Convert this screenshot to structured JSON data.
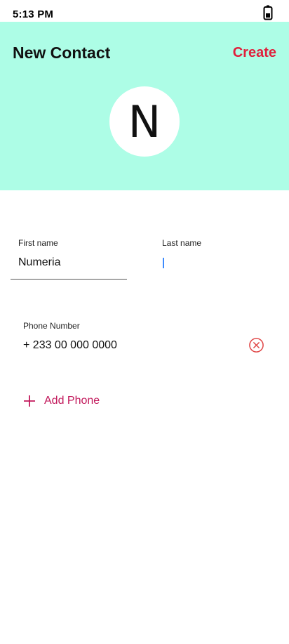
{
  "status_bar": {
    "time": "5:13 PM",
    "battery_icon": "battery-icon"
  },
  "header": {
    "title": "New Contact",
    "create_label": "Create",
    "avatar_letter": "N",
    "background_color": "#adfde6",
    "accent_color": "#e0203c"
  },
  "form": {
    "first_name": {
      "label": "First name",
      "value": "Numeria"
    },
    "last_name": {
      "label": "Last name",
      "value": ""
    },
    "phone": {
      "label": "Phone Number",
      "value": "+ 233 00 000 0000",
      "clear_icon": "close-circle-icon"
    },
    "add_phone": {
      "label": "Add Phone",
      "icon": "plus-icon"
    }
  }
}
